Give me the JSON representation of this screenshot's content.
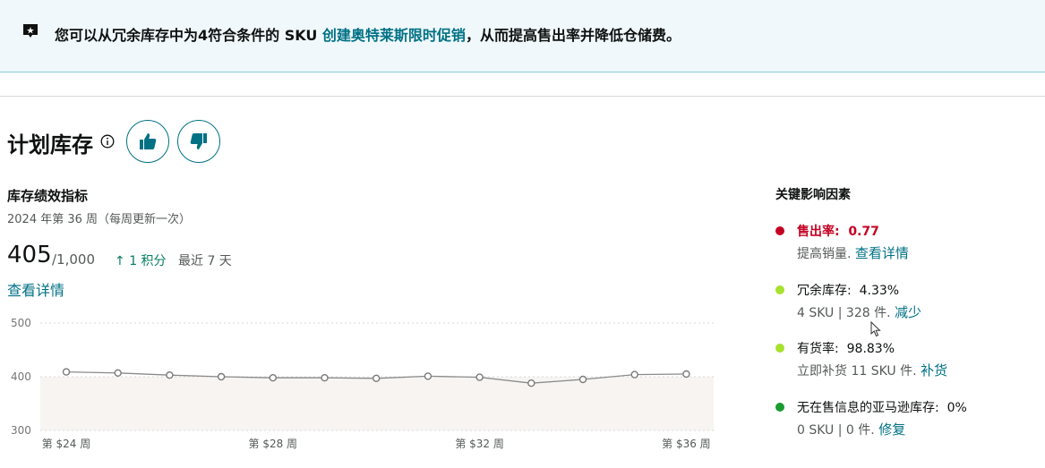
{
  "banner": {
    "text_before": "您可以从冗余库存中为4符合条件的 SKU ",
    "link": "创建奥特莱斯限时促销",
    "text_after": "，从而提高售出率并降低仓储费。"
  },
  "section": {
    "title": "计划库存",
    "metrics_title": "库存绩效指标",
    "week_label": "2024 年第 36 周（每周更新一次）",
    "score": "405",
    "score_of": "/1,000",
    "delta": "1 积分",
    "period": "最近 7 天",
    "details_link": "查看详情"
  },
  "factors": {
    "title": "关键影响因素",
    "items": [
      {
        "label": "售出率:",
        "value": "0.77",
        "sub": "提高销量.",
        "action": "查看详情",
        "color": "#c40022"
      },
      {
        "label": "冗余库存:",
        "value": "4.33%",
        "sub": "4 SKU | 328 件.",
        "action": "减少",
        "color": "#a6e22e"
      },
      {
        "label": "有货率:",
        "value": "98.83%",
        "sub": "立即补货 11 SKU 件.",
        "action": "补货",
        "color": "#a6e22e"
      },
      {
        "label": "无在售信息的亚马逊库存:",
        "value": "0%",
        "sub": "0 SKU | 0 件.",
        "action": "修复",
        "color": "#1a9c30"
      }
    ]
  },
  "chart_data": {
    "type": "line",
    "y_ticks": [
      "500",
      "400",
      "300"
    ],
    "ylim": [
      300,
      500
    ],
    "x_tick_labels": [
      "第 $24 周",
      "第 $28 周",
      "第 $32 周",
      "第 $36 周"
    ],
    "series": [
      {
        "values": [
          409,
          407,
          403,
          400,
          398,
          398,
          397,
          401,
          399,
          388,
          395,
          404,
          405
        ]
      }
    ],
    "grid": true
  }
}
